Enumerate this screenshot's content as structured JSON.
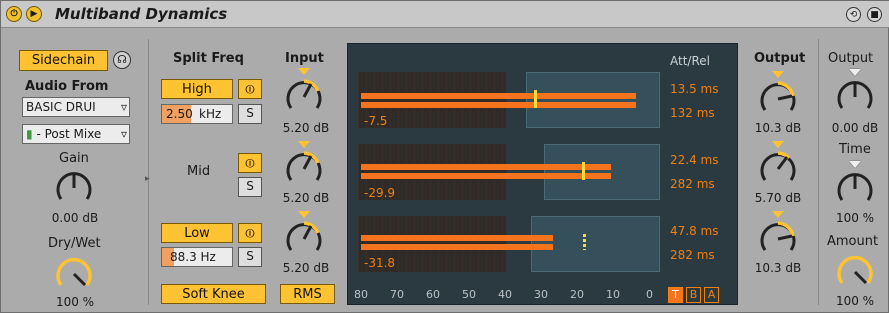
{
  "device": {
    "title": "Multiband Dynamics"
  },
  "left": {
    "sidechain_label": "Sidechain",
    "audio_from_label": "Audio From",
    "audio_source": "BASIC DRUI",
    "post_mixer": "- Post Mixe",
    "gain_label": "Gain",
    "gain_value": "0.00 dB",
    "drywet_label": "Dry/Wet",
    "drywet_value": "100 %"
  },
  "split": {
    "header": "Split Freq",
    "high_label": "High",
    "high_freq_value": "2.50",
    "high_freq_unit": "kHz",
    "mid_label": "Mid",
    "low_label": "Low",
    "low_freq_value": "88.3 Hz",
    "solo_label": "S",
    "soft_knee_label": "Soft Knee"
  },
  "input": {
    "header": "Input",
    "high_value": "5.20 dB",
    "mid_value": "5.20 dB",
    "low_value": "5.20 dB",
    "rms_label": "RMS"
  },
  "meters": {
    "att_rel_label": "Att/Rel",
    "bands": [
      {
        "level": "-7.5",
        "attack": "13.5 ms",
        "release": "132 ms"
      },
      {
        "level": "-29.9",
        "attack": "22.4 ms",
        "release": "282 ms"
      },
      {
        "level": "-31.8",
        "attack": "47.8 ms",
        "release": "282 ms"
      }
    ],
    "scale": [
      "80",
      "70",
      "60",
      "50",
      "40",
      "30",
      "20",
      "10",
      "0"
    ],
    "t_label": "T",
    "b_label": "B",
    "a_label": "A"
  },
  "output": {
    "header": "Output",
    "high_value": "10.3 dB",
    "mid_value": "5.70 dB",
    "low_value": "10.3 dB"
  },
  "global": {
    "output_label": "Output",
    "output_value": "0.00 dB",
    "time_label": "Time",
    "time_value": "100 %",
    "amount_label": "Amount",
    "amount_value": "100 %"
  },
  "colors": {
    "accent": "#ffc233",
    "meter_orange": "#f5731c",
    "meter_bg": "#2b3a40"
  }
}
